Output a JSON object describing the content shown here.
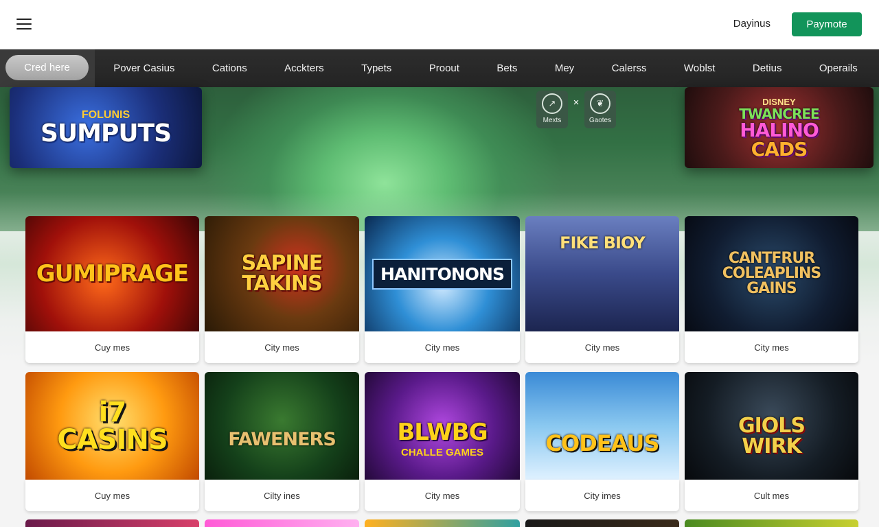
{
  "header": {
    "user_link": "Dayinus",
    "pay_button": "Paymote"
  },
  "nav": {
    "search_label": "Cred here",
    "items": [
      "Pover Casius",
      "Cations",
      "Acckters",
      "Typets",
      "Proout",
      "Bets",
      "Mey",
      "Calerss",
      "Woblst",
      "Detius",
      "Operails"
    ]
  },
  "hero": {
    "left_banner": {
      "sub": "FOLUNIS",
      "title": "SUMPUTS"
    },
    "right_banner": {
      "sub": "DISNEY",
      "title1": "TWANCREE",
      "title2": "HALINO",
      "title3": "CADS"
    },
    "mini_buttons": {
      "left": "Mexts",
      "right": "Gaotes",
      "close": "×"
    }
  },
  "games": [
    {
      "title": "GUMIPRAGE",
      "label": "Cuy mes",
      "color": "#ffc21a"
    },
    {
      "title": "SAPINE TAKINS",
      "label": "City mes",
      "color": "#ffd040"
    },
    {
      "title": "HANITONONS",
      "label": "City mes",
      "color": "#ffffff"
    },
    {
      "title": "FIKE BIOY",
      "label": "City mes",
      "color": "#ffe07a"
    },
    {
      "title": "CANTFRUR COLEAPLINS GAINS",
      "label": "City mes",
      "color": "#f0c060"
    },
    {
      "title": "i7 CASINS",
      "label": "Cuy mes",
      "color": "#ffdf1e"
    },
    {
      "title": "FAWENERS",
      "label": "Cilty ines",
      "color": "#e8c070"
    },
    {
      "title": "BLWBG",
      "sub": "CHALLE GAMES",
      "label": "City mes",
      "color": "#ffd21a"
    },
    {
      "title": "CODEAUS",
      "label": "City imes",
      "color": "#ffc21a"
    },
    {
      "title": "GIOLS WIRK",
      "label": "Cult mes",
      "color": "#f3d04a"
    }
  ]
}
